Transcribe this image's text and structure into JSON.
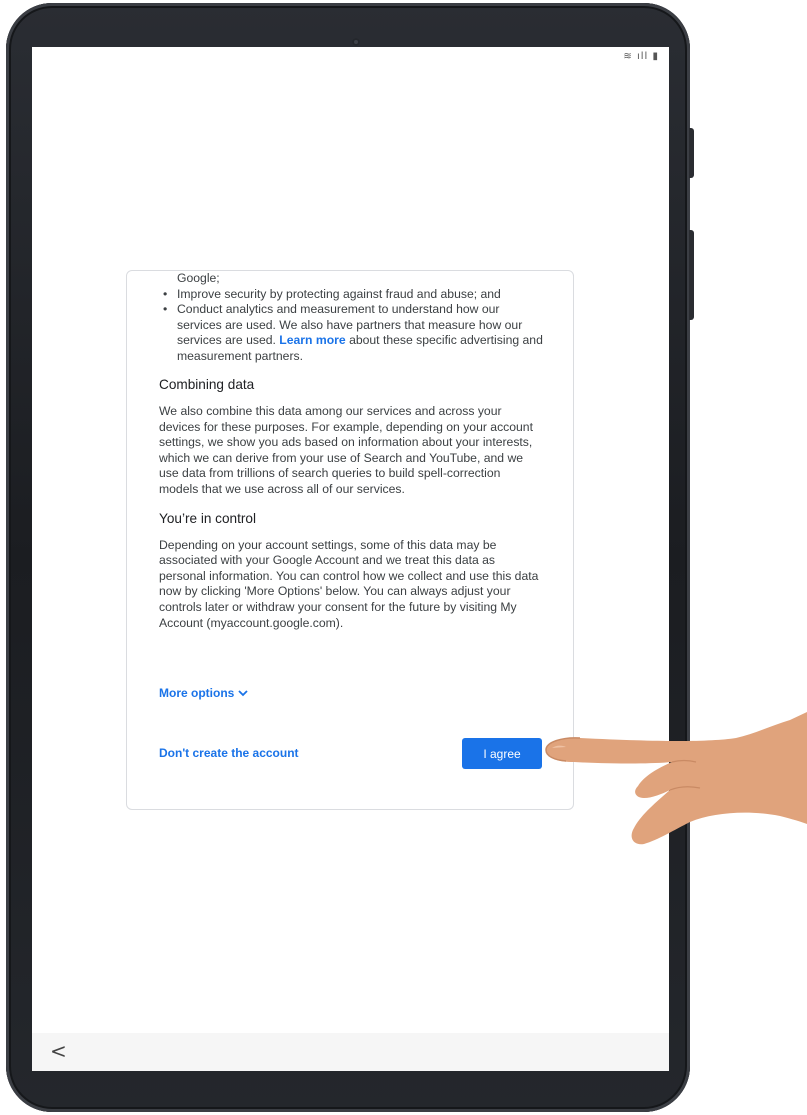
{
  "status_bar": {
    "icons": "wifi-icon signal-icon battery-icon",
    "glyphs": "≋ ıll ▮"
  },
  "consent": {
    "bullets": [
      {
        "has_dot": false,
        "text": "Google;"
      },
      {
        "has_dot": true,
        "text": "Improve security by protecting against fraud and abuse; and"
      },
      {
        "has_dot": true,
        "text_before": "Conduct analytics and measurement to understand how our services are used. We also have partners that measure how our services are used. ",
        "link": "Learn more",
        "text_after": " about these specific advertising and measurement partners."
      }
    ],
    "combining_heading": "Combining data",
    "combining_text": "We also combine this data among our services and across your devices for these purposes. For example, depending on your account settings, we show you ads based on information about your interests, which we can derive from your use of Search and YouTube, and we use data from trillions of search queries to build spell-correction models that we use across all of our services.",
    "control_heading": "You’re in control",
    "control_text": "Depending on your account settings, some of this data may be associated with your Google Account and we treat this data as personal information. You can control how we collect and use this data now by clicking 'More Options' below. You can always adjust your controls later or withdraw your consent for the future by visiting My Account (myaccount.google.com).",
    "more_options": "More options",
    "dont_create": "Don't create the account",
    "agree": "I agree"
  },
  "nav": {
    "back_glyph": "<"
  },
  "colors": {
    "accent": "#1a73e8",
    "text": "#3c4043",
    "border": "#dadce0"
  }
}
